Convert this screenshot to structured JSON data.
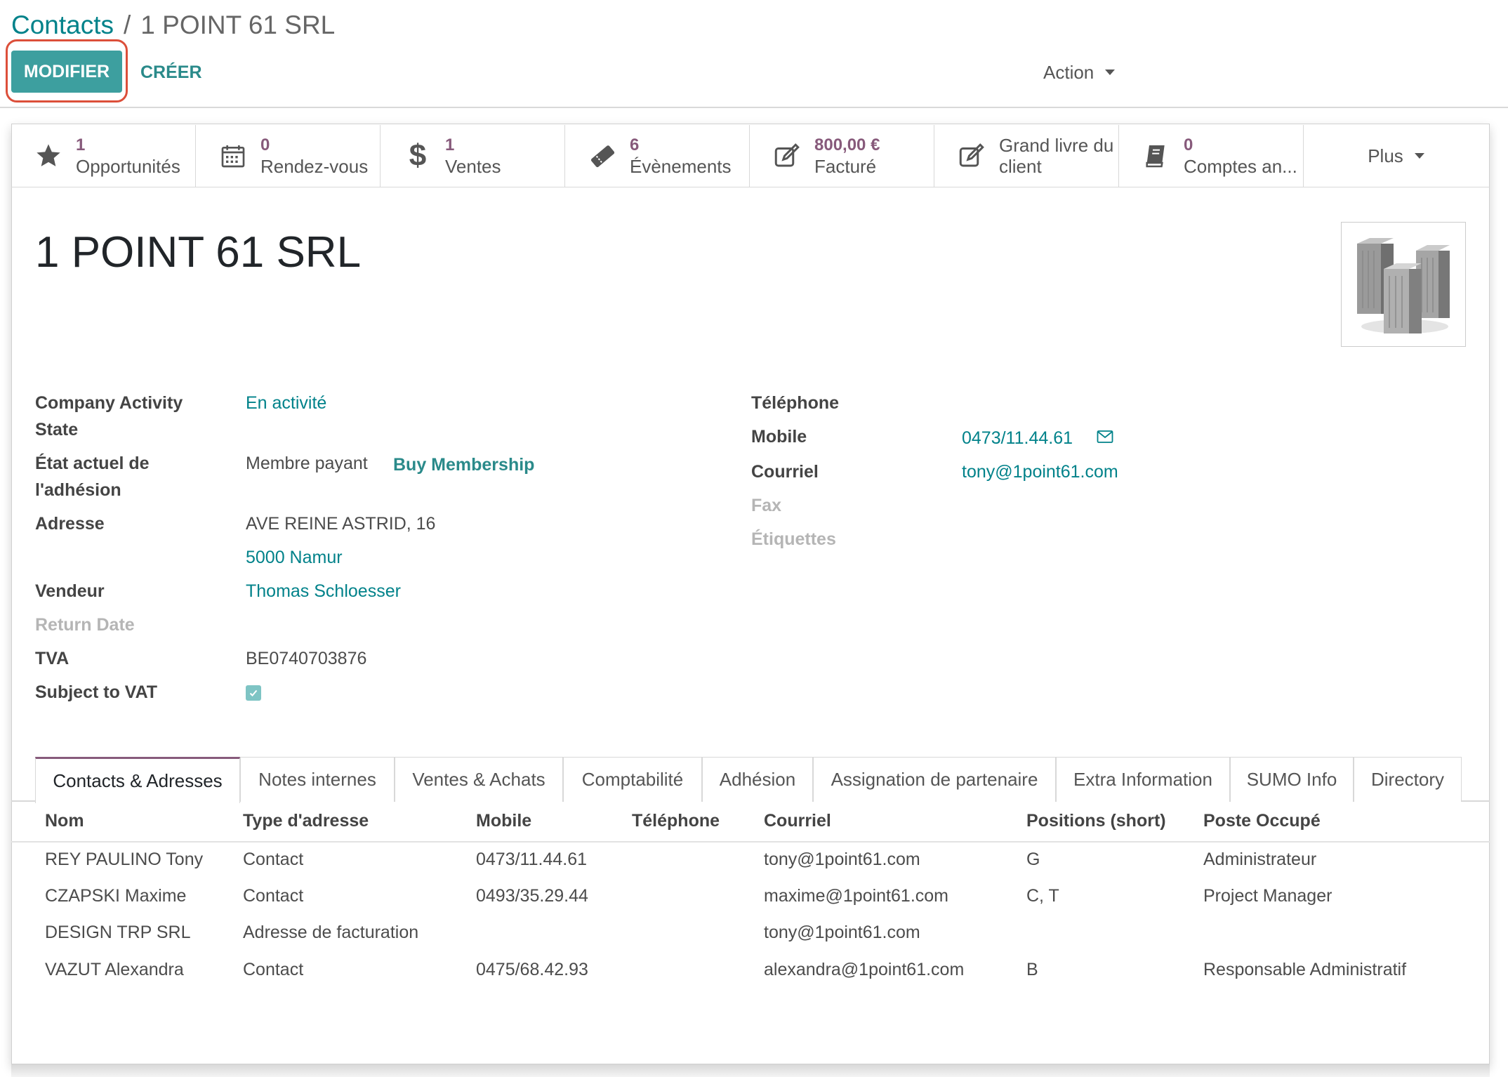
{
  "breadcrumb": {
    "parent": "Contacts",
    "separator": "/",
    "current": "1 POINT 61 SRL"
  },
  "toolbar": {
    "edit_label": "MODIFIER",
    "create_label": "CRÉER",
    "action_label": "Action"
  },
  "smart_buttons": [
    {
      "number": "1",
      "label": "Opportunités",
      "icon": "star-icon"
    },
    {
      "number": "0",
      "label": "Rendez-vous",
      "icon": "calendar-icon"
    },
    {
      "number": "1",
      "label": "Ventes",
      "icon": "dollar-icon"
    },
    {
      "number": "6",
      "label": "Évènements",
      "icon": "ticket-icon"
    },
    {
      "number": "800,00 €",
      "label": "Facturé",
      "icon": "edit-icon"
    },
    {
      "line1": "Grand livre du",
      "line2": "client",
      "icon": "edit-icon"
    },
    {
      "number": "0",
      "label": "Comptes an...",
      "icon": "book-icon"
    }
  ],
  "more_label": "Plus",
  "record": {
    "name": "1 POINT 61 SRL",
    "left": {
      "activity_state_label_1": "Company Activity",
      "activity_state_label_2": "State",
      "activity_state_value": "En activité",
      "membership_label_1": "État actuel de",
      "membership_label_2": "l'adhésion",
      "membership_value": "Membre payant",
      "buy_membership": "Buy Membership",
      "address_label": "Adresse",
      "address_street": "AVE REINE ASTRID, 16",
      "address_city": "5000 Namur",
      "salesperson_label": "Vendeur",
      "salesperson_value": "Thomas Schloesser",
      "return_date_label": "Return Date",
      "vat_label": "TVA",
      "vat_value": "BE0740703876",
      "subject_vat_label": "Subject to VAT",
      "subject_vat_checked": true
    },
    "right": {
      "phone_label": "Téléphone",
      "mobile_label": "Mobile",
      "mobile_value": "0473/11.44.61",
      "email_label": "Courriel",
      "email_value": "tony@1point61.com",
      "fax_label": "Fax",
      "tags_label": "Étiquettes"
    }
  },
  "tabs": [
    "Contacts & Adresses",
    "Notes internes",
    "Ventes & Achats",
    "Comptabilité",
    "Adhésion",
    "Assignation de partenaire",
    "Extra Information",
    "SUMO Info",
    "Directory"
  ],
  "contacts_table": {
    "columns": [
      "Nom",
      "Type d'adresse",
      "Mobile",
      "Téléphone",
      "Courriel",
      "Positions (short)",
      "Poste Occupé"
    ],
    "rows": [
      [
        "REY PAULINO Tony",
        "Contact",
        "0473/11.44.61",
        "",
        "tony@1point61.com",
        "G",
        "Administrateur"
      ],
      [
        "CZAPSKI Maxime",
        "Contact",
        "0493/35.29.44",
        "",
        "maxime@1point61.com",
        "C, T",
        "Project Manager"
      ],
      [
        "DESIGN TRP SRL",
        "Adresse de facturation",
        "",
        "",
        "tony@1point61.com",
        "",
        ""
      ],
      [
        "VAZUT Alexandra",
        "Contact",
        "0475/68.42.93",
        "",
        "alexandra@1point61.com",
        "B",
        "Responsable Administratif"
      ]
    ]
  },
  "colors": {
    "primary": "#3d9f9f",
    "link": "#01828a",
    "accent": "#875a7b",
    "highlight": "#dc4f3a"
  }
}
